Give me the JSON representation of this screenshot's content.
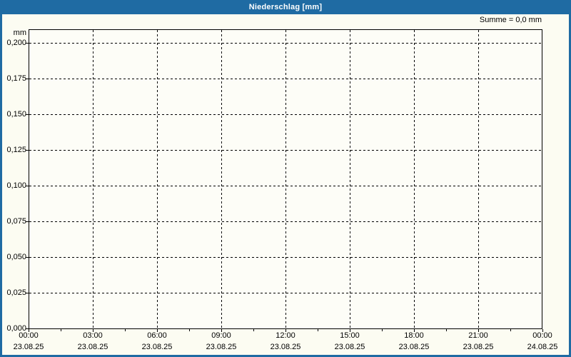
{
  "window": {
    "title": "Niederschlag [mm]"
  },
  "header": {
    "sum_label": "Summe = 0,0 mm"
  },
  "colors": {
    "titlebar": "#1f6ba3",
    "frame": "#1f6ba3",
    "title_text": "#ffffff",
    "background": "#fcfcf2",
    "plot_bg": "#fdfdf7",
    "grid": "#000000",
    "text": "#000000"
  },
  "chart_data": {
    "type": "bar",
    "title": "Niederschlag [mm]",
    "ylabel": "mm",
    "ylim": [
      0,
      0.2
    ],
    "y_tick_interval": 0.025,
    "y_tick_labels": [
      "0,200",
      "0,175",
      "0,150",
      "0,125",
      "0,100",
      "0,075",
      "0,050",
      "0,025",
      "0,000"
    ],
    "x_tick_labels": [
      {
        "time": "00:00",
        "date": "23.08.25"
      },
      {
        "time": "03:00",
        "date": "23.08.25"
      },
      {
        "time": "06:00",
        "date": "23.08.25"
      },
      {
        "time": "09:00",
        "date": "23.08.25"
      },
      {
        "time": "12:00",
        "date": "23.08.25"
      },
      {
        "time": "15:00",
        "date": "23.08.25"
      },
      {
        "time": "18:00",
        "date": "23.08.25"
      },
      {
        "time": "21:00",
        "date": "23.08.25"
      },
      {
        "time": "00:00",
        "date": "24.08.25"
      }
    ],
    "x_minor_ticks_between_major": 1,
    "grid": "dashed both axes",
    "legend": "none",
    "series": [
      {
        "name": "Niederschlag",
        "values": [],
        "total_mm": 0.0
      }
    ],
    "summary_label": "Summe = 0,0 mm"
  }
}
